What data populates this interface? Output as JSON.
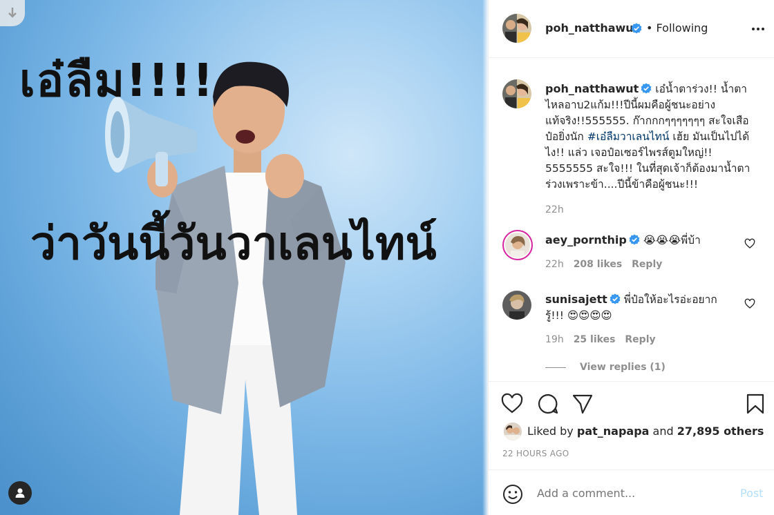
{
  "post_image": {
    "headline_top": "เอ๋ลืม!!!!",
    "headline_bottom": "ว่าวันนี้วันวาเลนไทน์"
  },
  "header": {
    "username": "poh_natthawut",
    "follow_status": "• Following"
  },
  "caption": {
    "username": "poh_natthawut",
    "text_before_tag": "เอ๋น้ำตาร่วง!! น้ำตาไหลอาบ2แก้ม!!!ปีนี้ผมคือผู้ชนะอย่างแท้จริง!!555555. ก๊ากกกๆๆๆๆๆๆๆ สะใจเสือป๋อยิ่งนัก ",
    "hashtag": "#เอ๋ลืมวาเลนไทน์",
    "text_after_tag": " เฮ้ย มันเป็นไปได้ไง!! แล่ว เจอป๋อเซอร์ไพรส์ตูมใหญ่!! 5555555 สะใจ!!! ในที่สุดเจ้าก็ต้องมาน้ำตาร่วงเพราะข้า....ปีนี้ข้าคือผู้ชนะ!!!",
    "age": "22h"
  },
  "comments": [
    {
      "username": "aey_pornthip",
      "text": "😭😭😭พี่บ้า",
      "age": "22h",
      "likes": "208 likes",
      "reply_label": "Reply"
    },
    {
      "username": "sunisajett",
      "text": "พี่ป๋อให้อะไรอ่ะอยากรู้!!! 😍😍😍😍",
      "age": "19h",
      "likes": "25 likes",
      "reply_label": "Reply",
      "view_replies": "View replies (1)"
    }
  ],
  "likes": {
    "prefix": "Liked by",
    "user": "pat_napapa",
    "joiner": "and",
    "others": "27,895 others"
  },
  "timestamp": "22 HOURS AGO",
  "add_comment": {
    "placeholder": "Add a comment...",
    "post_label": "Post"
  },
  "colors": {
    "verified": "#3897f0",
    "post_button_disabled": "#b2dffc",
    "hashtag": "#00376b",
    "muted": "#8e8e8e"
  }
}
